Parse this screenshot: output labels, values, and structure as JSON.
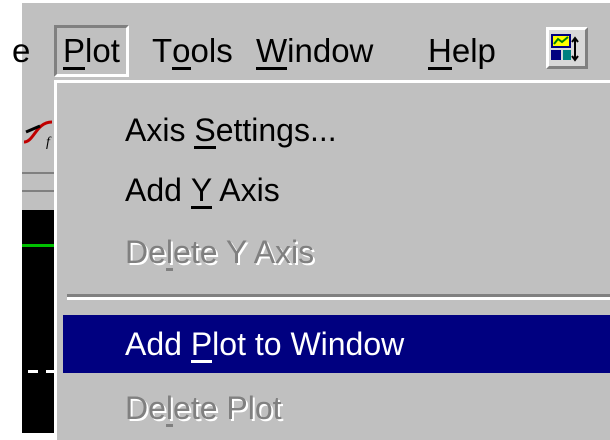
{
  "menubar": {
    "items": [
      {
        "label": "e",
        "underline_index": -1
      },
      {
        "label": "Plot",
        "underline_index": 0,
        "open": true
      },
      {
        "label": "Tools",
        "underline_index": 1
      },
      {
        "label": "Window",
        "underline_index": 0
      },
      {
        "label": "Help",
        "underline_index": 0
      }
    ],
    "toolbar_icon": "chart-properties-icon"
  },
  "dropdown": {
    "items": [
      {
        "label": "Axis Settings...",
        "underline_index": 5,
        "enabled": true,
        "selected": false
      },
      {
        "label": "Add Y Axis",
        "underline_index": 4,
        "enabled": true,
        "selected": false
      },
      {
        "label": "Delete Y Axis",
        "underline_index": 2,
        "enabled": false,
        "selected": false
      },
      {
        "separator": true
      },
      {
        "label": "Add Plot to Window",
        "underline_index": 4,
        "enabled": true,
        "selected": true
      },
      {
        "label": "Delete Plot",
        "underline_index": 2,
        "enabled": false,
        "selected": false
      }
    ]
  },
  "colors": {
    "menu_bg": "#c0c0c0",
    "highlight": "#000080",
    "disabled_text": "#808080",
    "plot_background": "#000000",
    "trace": "#00c000"
  }
}
